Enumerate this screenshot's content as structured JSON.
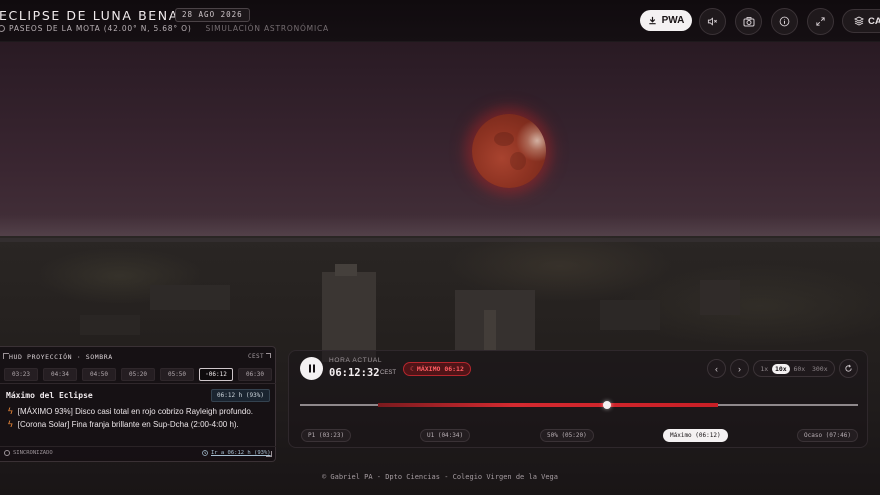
{
  "header": {
    "title": "ECLIPSE DE LUNA BENAVENTE",
    "date_badge": "28 AGO 2026",
    "location": "PASEOS DE LA MOTA (42.00° N, 5.68° O)",
    "subtitle": "SIMULACIÓN ASTRONÓMICA",
    "pwa_label": "PWA",
    "cal_label": "CAL",
    "icons": [
      "download-icon",
      "mute-icon",
      "camera-icon",
      "info-icon",
      "fullscreen-icon",
      "layers-icon"
    ]
  },
  "hud": {
    "title": "HUD PROYECCIÓN · SOMBRA",
    "timezone": "CEST",
    "chips": [
      "03:23",
      "04:34",
      "04:50",
      "05:20",
      "05:50",
      "◦06:12",
      "06:30"
    ],
    "active_chip": 5,
    "section_title": "Máximo del Eclipse",
    "section_badge": "06:12 h (93%)",
    "notes": [
      "[MÁXIMO 93%] Disco casi total en rojo cobrizo Rayleigh profundo.",
      "[Corona Solar] Fina franja brillante en Sup-Dcha (2:00-4:00 h)."
    ],
    "sync_label": "SINCRONIZADO",
    "goto_link": "Ir a 06:12 h (93%)"
  },
  "player": {
    "now_label": "HORA ACTUAL",
    "now_time": "06:12:32",
    "now_tz": "CEST",
    "phase_badge": "MÁXIMO 06:12",
    "speeds": [
      "1x",
      "10x",
      "60x",
      "300x"
    ],
    "active_speed": 1,
    "timeline": {
      "progress": 0.55,
      "eclipse_start": 0.14,
      "eclipse_end": 0.75
    },
    "markers": [
      "P1 (03:23)",
      "U1 (04:34)",
      "50% (05:20)",
      "Máximo (06:12)",
      "Ocaso (07:46)"
    ],
    "active_marker": 3
  },
  "footer": {
    "credits": "© Gabriel PA - Dpto Ciencias - Colegio Virgen de la Vega"
  },
  "colors": {
    "accent_red": "#d42a30",
    "moon": "#8e3322",
    "badge_text": "#ff5d63"
  }
}
